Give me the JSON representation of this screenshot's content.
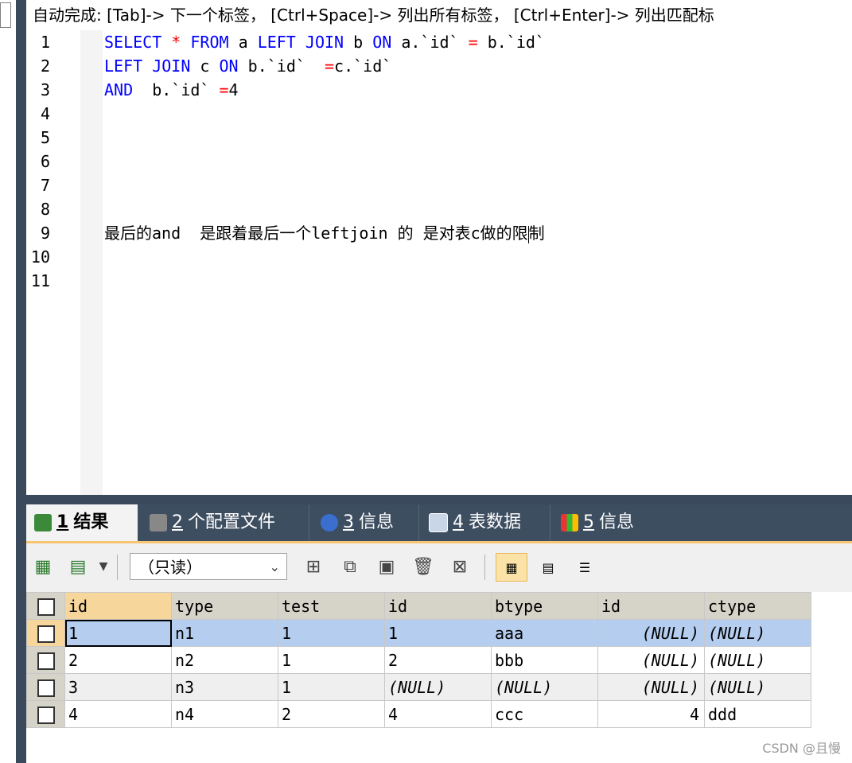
{
  "hint": "自动完成: [Tab]-> 下一个标签， [Ctrl+Space]-> 列出所有标签， [Ctrl+Enter]-> 列出匹配标",
  "editor": {
    "line_numbers": [
      "1",
      "2",
      "3",
      "4",
      "5",
      "6",
      "7",
      "8",
      "9",
      "10",
      "11"
    ],
    "line1": {
      "select": "SELECT",
      "star": "*",
      "from": "FROM",
      "a": " a ",
      "left": "LEFT",
      "join": "JOIN",
      "b": " b ",
      "on": "ON",
      "rest": " a.`id`",
      "eq": "=",
      "rest2": " b.`id`"
    },
    "line2": {
      "left": "LEFT",
      "join": "JOIN",
      "c": " c ",
      "on": "ON",
      "rest": " b.`id`  ",
      "eq": "=",
      "rest2": "c.`id`"
    },
    "line3": {
      "and": "AND",
      "rest": "  b.`id` ",
      "eq": "=",
      "rest2": "4"
    },
    "line9_comment_a": "最后的and  是跟着最后一个leftjoin 的 是对表c做的限",
    "line9_comment_b": "制"
  },
  "tabs": [
    {
      "num": "1",
      "label": "结果",
      "icon": "result-icon"
    },
    {
      "num": "2",
      "label": "个配置文件",
      "icon": "profile-icon"
    },
    {
      "num": "3",
      "label": "信息",
      "icon": "info-icon"
    },
    {
      "num": "4",
      "label": "表数据",
      "icon": "table-data-icon"
    },
    {
      "num": "5",
      "label": "信息",
      "icon": "info-color-icon"
    }
  ],
  "toolbar": {
    "readonly_select": "（只读）"
  },
  "grid": {
    "columns": [
      "id",
      "type",
      "test",
      "id",
      "btype",
      "id",
      "ctype"
    ],
    "rows": [
      [
        "1",
        "n1",
        "1",
        "1",
        "aaa",
        "(NULL)",
        "(NULL)"
      ],
      [
        "2",
        "n2",
        "1",
        "2",
        "bbb",
        "(NULL)",
        "(NULL)"
      ],
      [
        "3",
        "n3",
        "1",
        "(NULL)",
        "(NULL)",
        "(NULL)",
        "(NULL)"
      ],
      [
        "4",
        "n4",
        "2",
        "4",
        "ccc",
        "4",
        "ddd"
      ]
    ]
  },
  "watermark": "CSDN @且慢",
  "colors": {
    "keyword": "#0000ff",
    "operator": "#ff0000",
    "selected_row": "#b5cdee",
    "header": "#d6d3c9",
    "accent": "#f8c572"
  }
}
